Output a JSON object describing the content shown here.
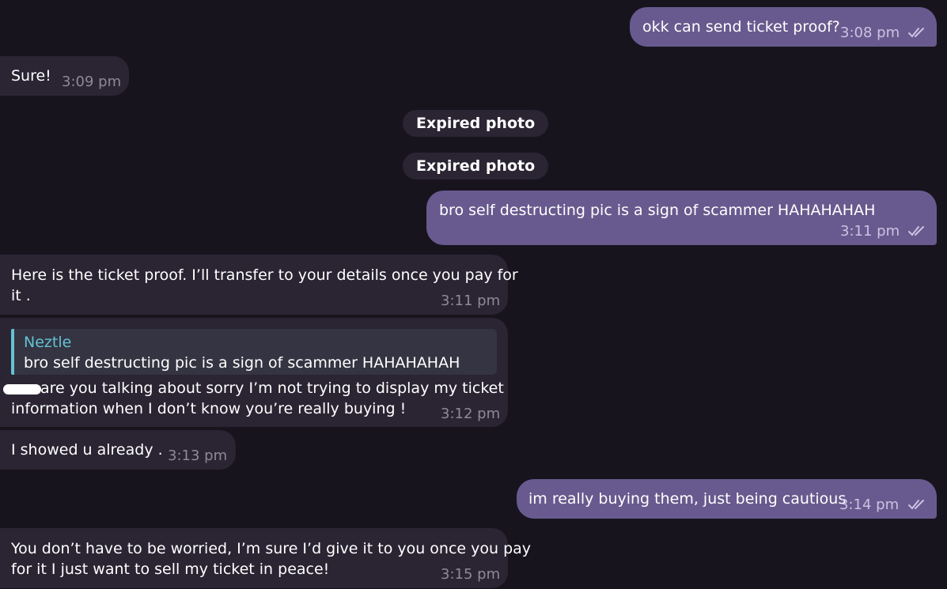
{
  "chat": {
    "messages": [
      {
        "direction": "outgoing",
        "text": "okk can send ticket proof?",
        "time": "3:08 pm",
        "status": "read"
      },
      {
        "direction": "incoming",
        "text": "Sure!",
        "time": "3:09 pm"
      },
      {
        "type": "service",
        "text": "Expired photo"
      },
      {
        "type": "service",
        "text": "Expired photo"
      },
      {
        "direction": "outgoing",
        "text": "bro self destructing pic is a sign of scammer HAHAHAHAH",
        "time": "3:11 pm",
        "status": "read"
      },
      {
        "direction": "incoming",
        "lines": [
          "Here is the ticket proof. I’ll transfer to your details once you pay for",
          "it ."
        ],
        "time": "3:11 pm"
      },
      {
        "direction": "incoming",
        "reply": {
          "name": "Neztle",
          "text": "bro self destructing pic is a sign of scammer HAHAHAHAH"
        },
        "lines": [
          "are you talking about sorry I’m not trying to display my ticket",
          "information when I don’t know you’re really buying !"
        ],
        "time": "3:12 pm",
        "redacted_prefix": true
      },
      {
        "direction": "incoming",
        "text": "I showed u already .",
        "time": "3:13 pm"
      },
      {
        "direction": "outgoing",
        "text": "im really buying them, just being cautious",
        "time": "3:14 pm",
        "status": "read"
      },
      {
        "direction": "incoming",
        "lines": [
          "You don’t have to be worried, I’m sure I’d give it to you once you pay",
          "for it I just want to sell my ticket in peace!"
        ],
        "time": "3:15 pm"
      }
    ]
  },
  "colors": {
    "background": "#17141e",
    "incoming_bubble": "#2a2433",
    "outgoing_bubble": "#685a8e",
    "reply_accent": "#62c3d3"
  },
  "icons": {
    "read_receipt": "double-check-icon"
  }
}
